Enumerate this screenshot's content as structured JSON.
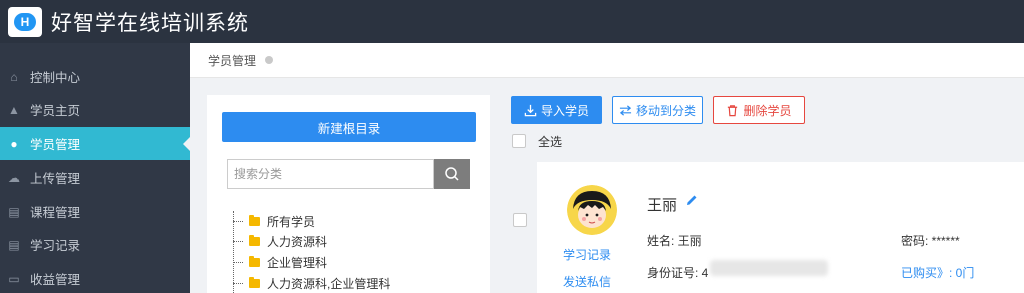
{
  "app": {
    "title": "好智学在线培训系统",
    "logo_letter": "H"
  },
  "sidebar": {
    "items": [
      {
        "label": "控制中心",
        "icon": "home-icon",
        "glyph": "⌂"
      },
      {
        "label": "学员主页",
        "icon": "graduation-cap-icon",
        "glyph": "▲"
      },
      {
        "label": "学员管理",
        "icon": "users-icon",
        "glyph": "●"
      },
      {
        "label": "上传管理",
        "icon": "cloud-upload-icon",
        "glyph": "☁"
      },
      {
        "label": "课程管理",
        "icon": "book-icon",
        "glyph": "▤"
      },
      {
        "label": "学习记录",
        "icon": "book-icon",
        "glyph": "▤"
      },
      {
        "label": "收益管理",
        "icon": "card-icon",
        "glyph": "▭"
      }
    ],
    "active_index": 2
  },
  "breadcrumb": {
    "current": "学员管理"
  },
  "category_panel": {
    "new_root_label": "新建根目录",
    "search_placeholder": "搜索分类",
    "tree": [
      "所有学员",
      "人力资源科",
      "企业管理科",
      "人力资源科,企业管理科"
    ]
  },
  "toolbar": {
    "import_label": "导入学员",
    "move_label": "移动到分类",
    "delete_label": "删除学员",
    "select_all_label": "全选"
  },
  "student": {
    "name": "王丽",
    "name_field": "姓名: 王丽",
    "id_label": "身份证号: 4",
    "password_field": "密码: ******",
    "purchased": "已购买》: 0门",
    "study_record_link": "学习记录",
    "send_message_link": "发送私信"
  },
  "colors": {
    "topbar": "#2b3340",
    "sidebar": "#303846",
    "active": "#31b9d2",
    "primary": "#2d8cf0",
    "danger": "#e6473f",
    "folder": "#f5b800"
  }
}
